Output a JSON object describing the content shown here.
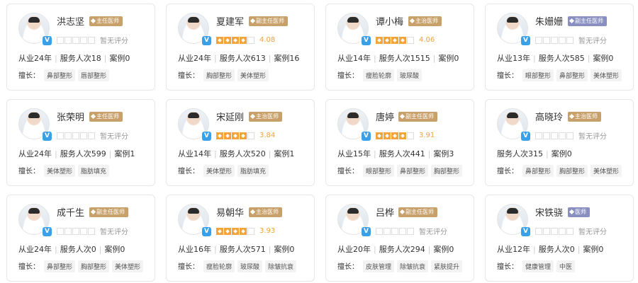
{
  "cards": [
    {
      "name": "洪志坚",
      "title": "主任医师",
      "title_color": "#c8a06a",
      "stars": 0,
      "score": "暂无评分",
      "rated": false,
      "years": "从业24年",
      "served": "服务人次18",
      "cases": "案例0",
      "spec_label": "擅长：",
      "specs": [
        "鼻部整形",
        "唇部整形"
      ]
    },
    {
      "name": "夏建军",
      "title": "副主任医师",
      "title_color": "#c8a06a",
      "stars": 4,
      "score": "4.08",
      "rated": true,
      "years": "从业24年",
      "served": "服务人次613",
      "cases": "案例16",
      "spec_label": "擅长：",
      "specs": [
        "胸部整形",
        "美体塑形"
      ]
    },
    {
      "name": "谭小梅",
      "title": "主治医师",
      "title_color": "#c8a06a",
      "stars": 4,
      "score": "4.06",
      "rated": true,
      "years": "从业14年",
      "served": "服务人次1515",
      "cases": "案例0",
      "spec_label": "擅长：",
      "specs": [
        "瘦脸轮廓",
        "玻尿酸"
      ]
    },
    {
      "name": "朱姗姗",
      "title": "副主任医师",
      "title_color": "#8a8fc2",
      "stars": 0,
      "score": "暂无评分",
      "rated": false,
      "years": "从业13年",
      "served": "服务人次585",
      "cases": "案例0",
      "spec_label": "擅长：",
      "specs": [
        "眼部整形",
        "鼻部整形",
        "美体塑形"
      ]
    },
    {
      "name": "张荣明",
      "title": "主任医师",
      "title_color": "#c8a06a",
      "stars": 0,
      "score": "暂无评分",
      "rated": false,
      "years": "从业24年",
      "served": "服务人次599",
      "cases": "案例1",
      "spec_label": "擅长：",
      "specs": [
        "美体塑形",
        "脂肪填充"
      ]
    },
    {
      "name": "宋延刚",
      "title": "主治医师",
      "title_color": "#c8a06a",
      "stars": 4,
      "score": "3.84",
      "rated": true,
      "years": "从业14年",
      "served": "服务人次520",
      "cases": "案例1",
      "spec_label": "擅长：",
      "specs": [
        "美体塑形",
        "脂肪填充"
      ]
    },
    {
      "name": "唐婷",
      "title": "副主任医师",
      "title_color": "#c8a06a",
      "stars": 4,
      "score": "3.91",
      "rated": true,
      "years": "从业15年",
      "served": "服务人次441",
      "cases": "案例3",
      "spec_label": "擅长：",
      "specs": [
        "眼部整形",
        "鼻部整形",
        "胸部整形"
      ]
    },
    {
      "name": "高晓玲",
      "title": "主治医师",
      "title_color": "#c8a06a",
      "stars": 0,
      "score": "暂无评分",
      "rated": false,
      "years": "",
      "served": "服务人次315",
      "cases": "案例0",
      "spec_label": "擅长：",
      "specs": [
        "鼻部整形",
        "胸部整形",
        "美体塑形"
      ]
    },
    {
      "name": "成千生",
      "title": "副主任医师",
      "title_color": "#c8a06a",
      "stars": 0,
      "score": "暂无评分",
      "rated": false,
      "years": "从业24年",
      "served": "服务人次0",
      "cases": "案例0",
      "spec_label": "擅长：",
      "specs": [
        "鼻部整形",
        "胸部整形",
        "美体塑形"
      ]
    },
    {
      "name": "易朝华",
      "title": "主治医师",
      "title_color": "#c8a06a",
      "stars": 4,
      "score": "3.93",
      "rated": true,
      "years": "从业16年",
      "served": "服务人次571",
      "cases": "案例0",
      "spec_label": "擅长：",
      "specs": [
        "瘦脸轮廓",
        "玻尿酸",
        "除皱抗衰"
      ]
    },
    {
      "name": "吕桦",
      "title": "副主任医师",
      "title_color": "#c8a06a",
      "stars": 0,
      "score": "暂无评分",
      "rated": false,
      "years": "从业20年",
      "served": "服务人次294",
      "cases": "案例0",
      "spec_label": "擅长：",
      "specs": [
        "皮肤管理",
        "除皱抗衰",
        "紧肤提升"
      ]
    },
    {
      "name": "宋铁骁",
      "title": "医师",
      "title_color": "#8a8fc2",
      "stars": 0,
      "score": "暂无评分",
      "rated": false,
      "years": "从业12年",
      "served": "服务人次0",
      "cases": "案例0",
      "spec_label": "擅长：",
      "specs": [
        "健康管理",
        "中医"
      ]
    }
  ]
}
